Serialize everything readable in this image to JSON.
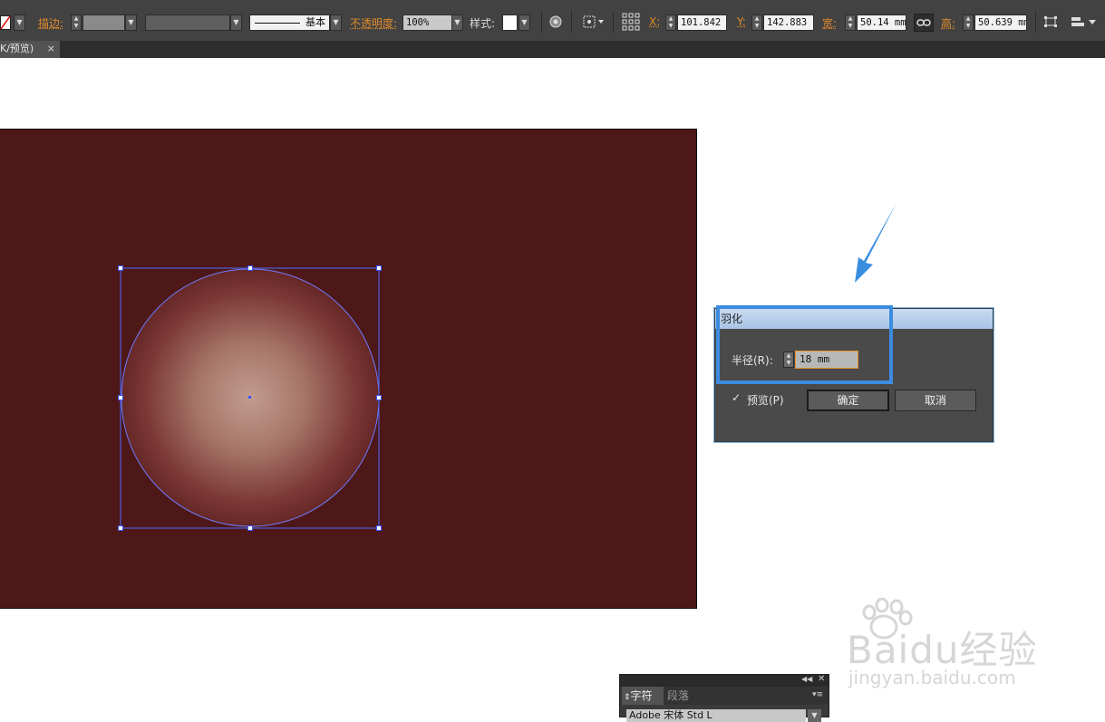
{
  "toolbar": {
    "stroke_label": "描边:",
    "stroke_profile": "基本",
    "opacity_label": "不透明度:",
    "opacity_value": "100%",
    "style_label": "样式:",
    "x_label": "X:",
    "x_value": "101.842 r",
    "y_label": "Y:",
    "y_value": "142.883 r",
    "width_label": "宽:",
    "width_value": "50.14 mm",
    "height_label": "高:",
    "height_value": "50.639 mm"
  },
  "document_tab": {
    "title": "K/预览)",
    "close": "×"
  },
  "feather_dialog": {
    "title": "羽化",
    "radius_label": "半径(R):",
    "radius_value": "18 mm",
    "preview_checked": true,
    "preview_label": "预览(P)",
    "ok_label": "确定",
    "cancel_label": "取消"
  },
  "character_panel": {
    "tab_character": "字符",
    "tab_paragraph": "段落",
    "font_value": "Adobe 宋体 Std L"
  },
  "watermark": {
    "line1": "Baidu经验",
    "line2": "jingyan.baidu.com"
  },
  "colors": {
    "artboard": "#4e1718",
    "accent_highlight": "#3b8ce0",
    "label_orange": "#e08a2c",
    "selection": "#4c6bff"
  },
  "icons": [
    "no-fill-icon",
    "globe-icon",
    "transform-icon",
    "reference-point-icon",
    "link-icon",
    "align-icon",
    "panel-menu-icon",
    "arrow-annotation",
    "checkbox-icon"
  ]
}
